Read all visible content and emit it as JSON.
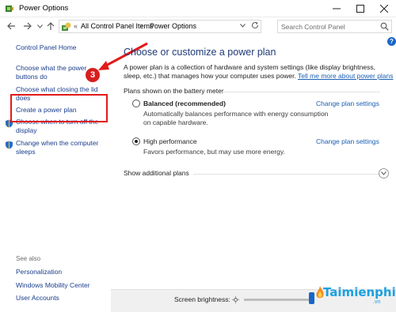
{
  "window": {
    "title": "Power Options"
  },
  "nav": {
    "crumb1": "All Control Panel Items",
    "crumb2": "Power Options",
    "search_placeholder": "Search Control Panel",
    "chevrons": "«"
  },
  "left": {
    "home": "Control Panel Home",
    "items": [
      "Choose what the power buttons do",
      "Choose what closing the lid does",
      "Create a power plan",
      "Choose when to turn off the display",
      "Change when the computer sleeps"
    ],
    "see_also": "See also",
    "see_also_items": [
      "Personalization",
      "Windows Mobility Center",
      "User Accounts"
    ]
  },
  "annotation": {
    "step": "3",
    "color": "#e21a1a"
  },
  "main": {
    "heading": "Choose or customize a power plan",
    "desc": "A power plan is a collection of hardware and system settings (like display brightness, sleep, etc.) that manages how your computer uses power.",
    "desc_link": "Tell me more about power plans",
    "subhead": "Plans shown on the battery meter",
    "plans": [
      {
        "name": "Balanced (recommended)",
        "desc": "Automatically balances performance with energy consumption on capable hardware.",
        "link": "Change plan settings",
        "selected": false
      },
      {
        "name": "High performance",
        "desc": "Favors performance, but may use more energy.",
        "link": "Change plan settings",
        "selected": true
      }
    ],
    "additional": "Show additional plans"
  },
  "bottom": {
    "brightness_label": "Screen brightness:",
    "brightness_level": 0.97
  },
  "watermark": {
    "text": "Taimienphi",
    "sub": ".vn"
  },
  "colors": {
    "link": "#1a5fb4",
    "heading": "#1e3a78",
    "accent": "#1a66c8"
  }
}
